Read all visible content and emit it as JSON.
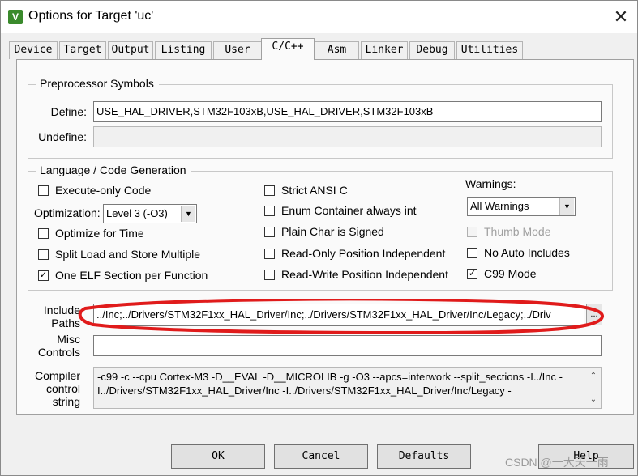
{
  "window": {
    "title": "Options for Target 'uc'",
    "app_icon": "V",
    "close_glyph": "✕"
  },
  "tabs": [
    {
      "label": "Device"
    },
    {
      "label": "Target"
    },
    {
      "label": "Output"
    },
    {
      "label": "Listing"
    },
    {
      "label": "User"
    },
    {
      "label": "C/C++"
    },
    {
      "label": "Asm"
    },
    {
      "label": "Linker"
    },
    {
      "label": "Debug"
    },
    {
      "label": "Utilities"
    }
  ],
  "active_tab": "C/C++",
  "preprocessor": {
    "title": "Preprocessor Symbols",
    "define_label": "Define:",
    "define_value": "USE_HAL_DRIVER,STM32F103xB,USE_HAL_DRIVER,STM32F103xB",
    "undefine_label": "Undefine:",
    "undefine_value": ""
  },
  "language": {
    "title": "Language / Code Generation",
    "execute_only": {
      "label": "Execute-only Code",
      "checked": false
    },
    "optimization_label": "Optimization:",
    "optimization_value": "Level 3 (-O3)",
    "optimize_time": {
      "label": "Optimize for Time",
      "checked": false
    },
    "split_load": {
      "label": "Split Load and Store Multiple",
      "checked": false
    },
    "one_elf": {
      "label": "One ELF Section per Function",
      "checked": true
    },
    "strict_ansi": {
      "label": "Strict ANSI C",
      "checked": false
    },
    "enum_container": {
      "label": "Enum Container always int",
      "checked": false
    },
    "plain_char": {
      "label": "Plain Char is Signed",
      "checked": false
    },
    "ropi": {
      "label": "Read-Only Position Independent",
      "checked": false
    },
    "rwpi": {
      "label": "Read-Write Position Independent",
      "checked": false
    },
    "warnings_label": "Warnings:",
    "warnings_value": "All Warnings",
    "thumb_mode": {
      "label": "Thumb Mode",
      "checked": false,
      "disabled": true
    },
    "no_auto_includes": {
      "label": "No Auto Includes",
      "checked": false
    },
    "c99_mode": {
      "label": "C99 Mode",
      "checked": true
    }
  },
  "include": {
    "label_line1": "Include",
    "label_line2": "Paths",
    "value": "../Inc;../Drivers/STM32F1xx_HAL_Driver/Inc;../Drivers/STM32F1xx_HAL_Driver/Inc/Legacy;../Driv",
    "browse_label": "..."
  },
  "misc": {
    "label_line1": "Misc",
    "label_line2": "Controls",
    "value": ""
  },
  "compiler": {
    "label_line1": "Compiler",
    "label_line2": "control",
    "label_line3": "string",
    "line1": "-c99 -c --cpu Cortex-M3 -D__EVAL -D__MICROLIB -g -O3 --apcs=interwork --split_sections -I../Inc -",
    "line2": "I../Drivers/STM32F1xx_HAL_Driver/Inc -I../Drivers/STM32F1xx_HAL_Driver/Inc/Legacy -"
  },
  "buttons": {
    "ok": "OK",
    "cancel": "Cancel",
    "defaults": "Defaults",
    "help": "Help"
  },
  "annotation_color": "#e01b1b",
  "watermark": "CSDN @一大天一雨"
}
